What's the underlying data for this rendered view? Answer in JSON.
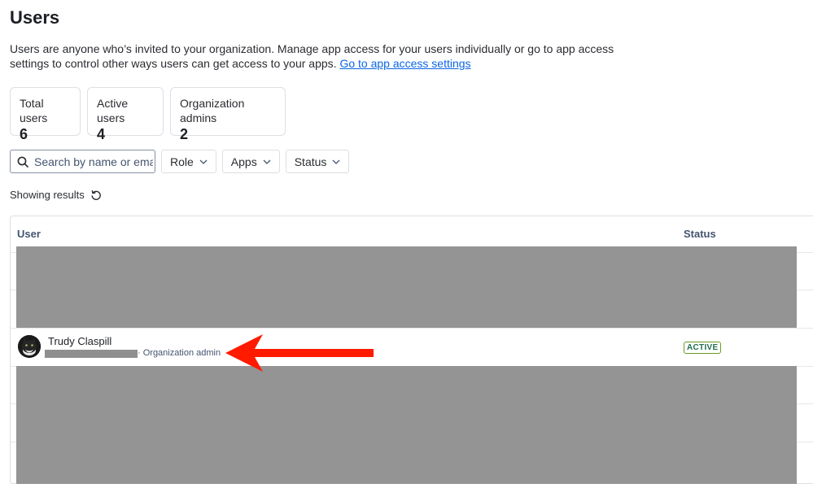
{
  "page": {
    "title": "Users",
    "description": "Users are anyone who’s invited to your organization. Manage app access for your users individually or go to app access settings to control other ways users can get access to your apps.",
    "description_link": "Go to app access settings"
  },
  "stats": [
    {
      "label": "Total users",
      "value": "6"
    },
    {
      "label": "Active users",
      "value": "4"
    },
    {
      "label": "Organization admins",
      "value": "2"
    }
  ],
  "filters": {
    "search_placeholder": "Search by name or email",
    "role_label": "Role",
    "apps_label": "Apps",
    "status_label": "Status"
  },
  "results": {
    "label": "Showing results"
  },
  "table": {
    "columns": {
      "user": "User",
      "status": "Status"
    },
    "rows": [
      {
        "name": "Trudy Claspill",
        "role": "· Organization admin",
        "status": "ACTIVE"
      }
    ]
  },
  "icons": {
    "search": "search-icon",
    "chevron": "chevron-down-icon",
    "refresh": "refresh-icon",
    "annotation": "arrow-annotation"
  },
  "colors": {
    "link": "#0c66e4",
    "annotation": "#ff1a00",
    "active_border": "#6a9a23",
    "redaction": "#949494"
  }
}
